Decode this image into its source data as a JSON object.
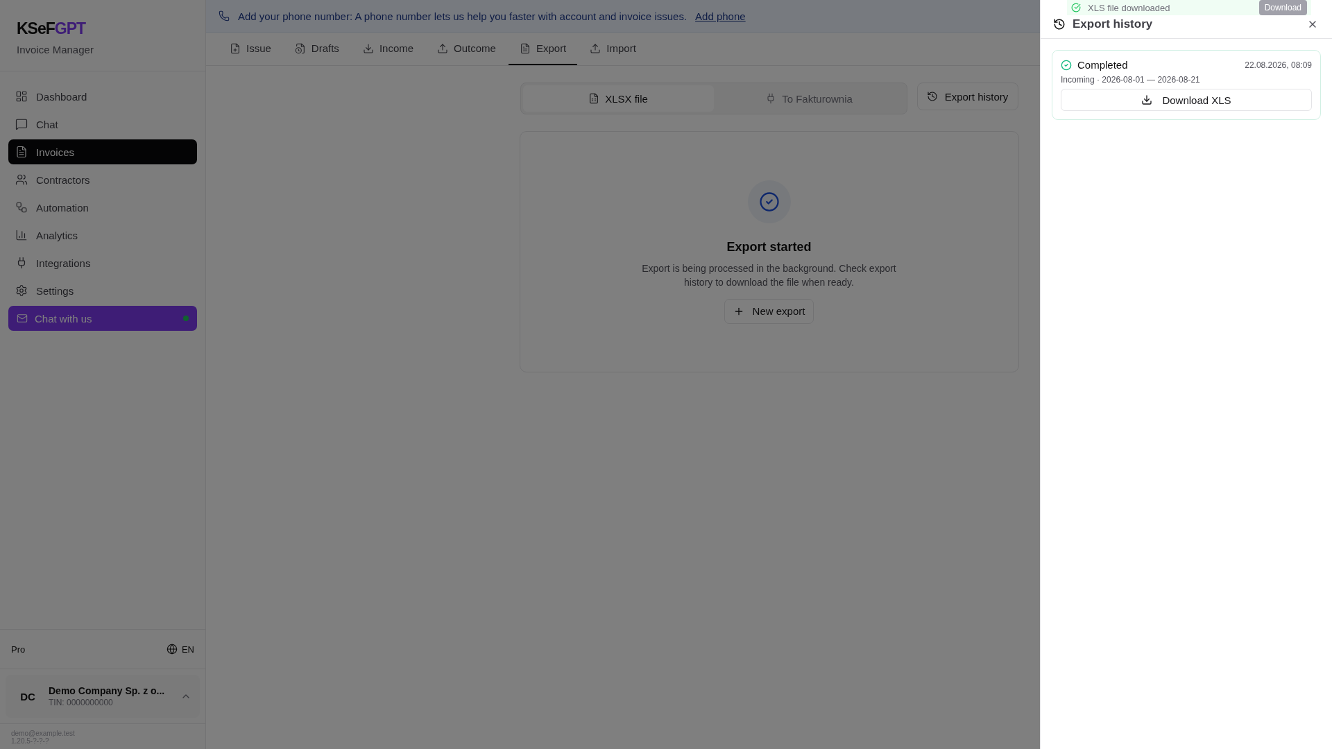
{
  "sidebar": {
    "brand": {
      "dark": "KSeF",
      "accent": "GPT"
    },
    "subtitle": "Invoice Manager",
    "nav": [
      {
        "label": "Dashboard",
        "selected": false
      },
      {
        "label": "Chat",
        "selected": false
      },
      {
        "label": "Invoices",
        "selected": true
      },
      {
        "label": "Contractors",
        "selected": false
      },
      {
        "label": "Automation",
        "selected": false
      },
      {
        "label": "Analytics",
        "selected": false
      },
      {
        "label": "Integrations",
        "selected": false
      },
      {
        "label": "Settings",
        "selected": false
      }
    ],
    "chat_button": {
      "label": "Chat with us",
      "online": true
    },
    "plan": "Pro",
    "language": "EN",
    "account": {
      "initials": "DC",
      "name": "Demo Company Sp. z o...",
      "tin": "TIN: 0000000000",
      "expanded": false
    },
    "footer": {
      "email": "demo@example.test",
      "version": "1.20.5-?-?-?"
    }
  },
  "banner": {
    "text": "Add your phone number: A phone number lets us help you faster with account and invoice issues.",
    "link": "Add phone"
  },
  "tabs": [
    {
      "label": "Issue",
      "selected": false
    },
    {
      "label": "Drafts",
      "selected": false
    },
    {
      "label": "Income",
      "selected": false
    },
    {
      "label": "Outcome",
      "selected": false
    },
    {
      "label": "Export",
      "selected": true
    },
    {
      "label": "Import",
      "selected": false
    }
  ],
  "export_modes": [
    {
      "label": "XLSX file",
      "selected": true
    },
    {
      "label": "To Fakturownia",
      "selected": false
    }
  ],
  "history_button": "Export history",
  "result": {
    "title": "Export started",
    "message": "Export is being processed in the background. Check export history to download the file when ready.",
    "button": "New export"
  },
  "sheet": {
    "title": "Export history",
    "toast": {
      "text": "XLS file downloaded",
      "button": "Download"
    },
    "entries": [
      {
        "status": "Completed",
        "timestamp": "22.08.2026, 08:09",
        "details": "Incoming · 2026-08-01 — 2026-08-21",
        "button": "Download XLS"
      }
    ]
  }
}
